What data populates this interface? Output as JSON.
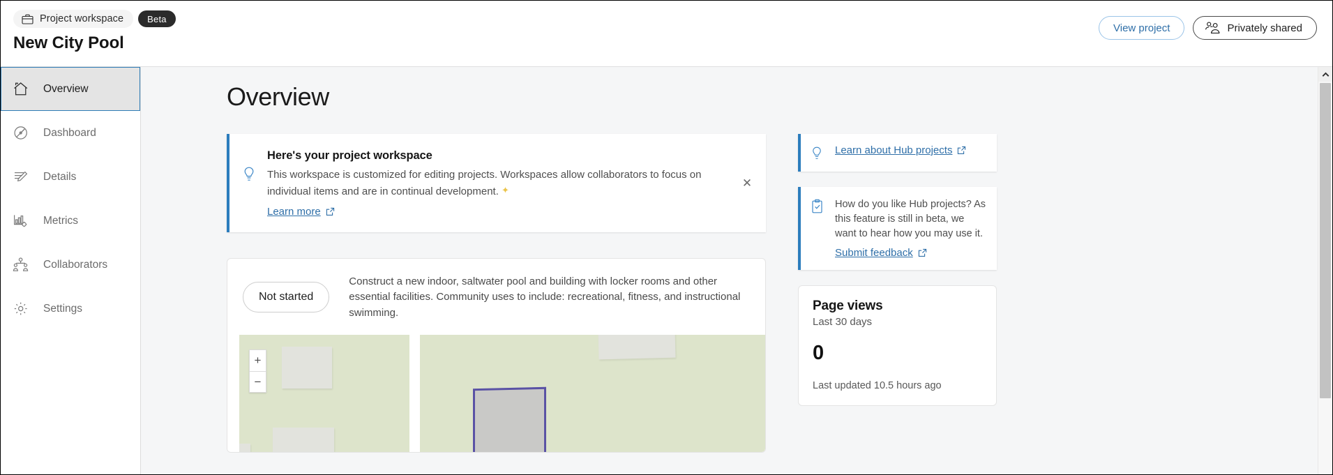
{
  "header": {
    "workspace_badge": "Project workspace",
    "workspace_icon": "briefcase-icon",
    "beta_badge": "Beta",
    "project_title": "New City Pool",
    "view_project_label": "View project",
    "privately_shared_label": "Privately shared",
    "privately_shared_icon": "group-users-icon",
    "accent_blue": "#2f6fa8",
    "outline_blue": "#9bc4e8"
  },
  "sidebar": {
    "items": [
      {
        "label": "Overview",
        "icon": "home-icon",
        "active": true
      },
      {
        "label": "Dashboard",
        "icon": "gauge-icon",
        "active": false
      },
      {
        "label": "Details",
        "icon": "edit-lines-icon",
        "active": false
      },
      {
        "label": "Metrics",
        "icon": "bar-chart-gear-icon",
        "active": false
      },
      {
        "label": "Collaborators",
        "icon": "people-network-icon",
        "active": false
      },
      {
        "label": "Settings",
        "icon": "gear-icon",
        "active": false
      }
    ],
    "active_border_color": "#2e7bb5",
    "active_bg_color": "#e4e4e4"
  },
  "main": {
    "page_title": "Overview",
    "notice": {
      "icon": "lightbulb-icon",
      "title": "Here's your project workspace",
      "text": "This workspace is customized for editing projects. Workspaces allow collaborators to focus on individual items and are in continual development.",
      "sparkle": "✦",
      "link_label": "Learn more",
      "link_icon": "external-link-icon",
      "close_icon": "close-icon",
      "accent_color": "#2c7dbd"
    },
    "project_card": {
      "status": "Not started",
      "description": "Construct a new indoor, saltwater pool and building with locker rooms and other essential facilities. Community uses to include: recreational, fitness, and instructional swimming.",
      "map": {
        "zoom_in": "+",
        "zoom_out": "−",
        "zoom_in_icon": "plus-icon",
        "zoom_out_icon": "minus-icon",
        "land_color": "#dde4cb",
        "building_color": "#e2e3dd",
        "parcel_outline_color": "#5a52a5"
      }
    }
  },
  "right_rail": {
    "learn_card": {
      "icon": "lightbulb-icon",
      "link_label": "Learn about Hub projects",
      "link_icon": "external-link-icon"
    },
    "feedback_card": {
      "icon": "clipboard-check-icon",
      "text": "How do you like Hub projects? As this feature is still in beta, we want to hear how you may use it.",
      "link_label": "Submit feedback",
      "link_icon": "external-link-icon"
    },
    "page_views_card": {
      "title": "Page views",
      "subtitle": "Last 30 days",
      "value": "0",
      "footer": "Last updated 10.5 hours ago"
    }
  },
  "scrollbar": {
    "up_arrow_icon": "chevron-up-icon"
  }
}
